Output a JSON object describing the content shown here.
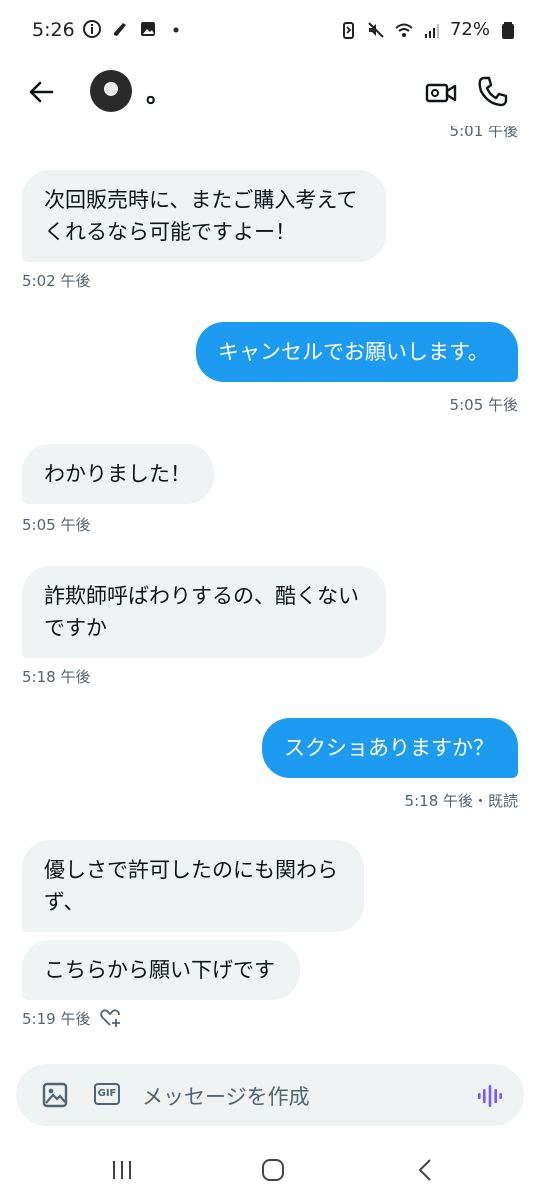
{
  "status_bar": {
    "time": "5:26",
    "battery": "72%"
  },
  "header": {
    "contact_name": "。"
  },
  "messages": [
    {
      "direction": "in",
      "text": "",
      "time": "5:01 午後"
    },
    {
      "direction": "in",
      "text": "次回販売時に、またご購入考えてくれるなら可能ですよー！",
      "time": "5:02 午後"
    },
    {
      "direction": "out",
      "text": "キャンセルでお願いします。",
      "time": "5:05 午後"
    },
    {
      "direction": "in",
      "text": "わかりました！",
      "time": "5:05 午後"
    },
    {
      "direction": "in",
      "text": "詐欺師呼ばわりするの、酷くないですか",
      "time": "5:18 午後"
    },
    {
      "direction": "out",
      "text": "スクショありますか？",
      "time": "5:18 午後・既読"
    },
    {
      "direction": "in",
      "text": "優しさで許可したのにも関わらず、",
      "time": ""
    },
    {
      "direction": "in",
      "text": "こちらから願い下げです",
      "time": "5:19 午後"
    }
  ],
  "composer": {
    "placeholder": "メッセージを作成",
    "gif_label": "GIF"
  },
  "colors": {
    "accent": "#1d9bf0",
    "incoming_bubble": "#eff3f4",
    "voice_icon": "#7856ff"
  }
}
